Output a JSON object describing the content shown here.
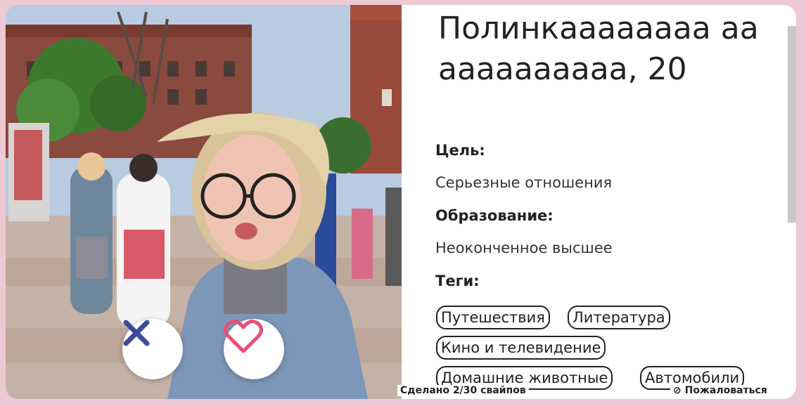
{
  "profile": {
    "name": "Полинкаааааааа аааааааааааа, 20",
    "goal_label": "Цель:",
    "goal_value": "Серьезные отношения",
    "education_label": "Образование:",
    "education_value": "Неоконченное высшее",
    "tags_label": "Теги:",
    "tags": [
      "Путешествия",
      "Литература",
      "Кино и телевидение",
      "Домашние животные",
      "Автомобили"
    ]
  },
  "actions": {
    "dislike_icon": "close-icon",
    "like_icon": "heart-icon"
  },
  "footer": {
    "swipe_counter": "Сделано 2/30 свайпов",
    "report": "⊘ Пожаловаться"
  },
  "colors": {
    "background": "#ecc9d3",
    "dislike": "#3f4a9c",
    "like": "#e84e78"
  }
}
